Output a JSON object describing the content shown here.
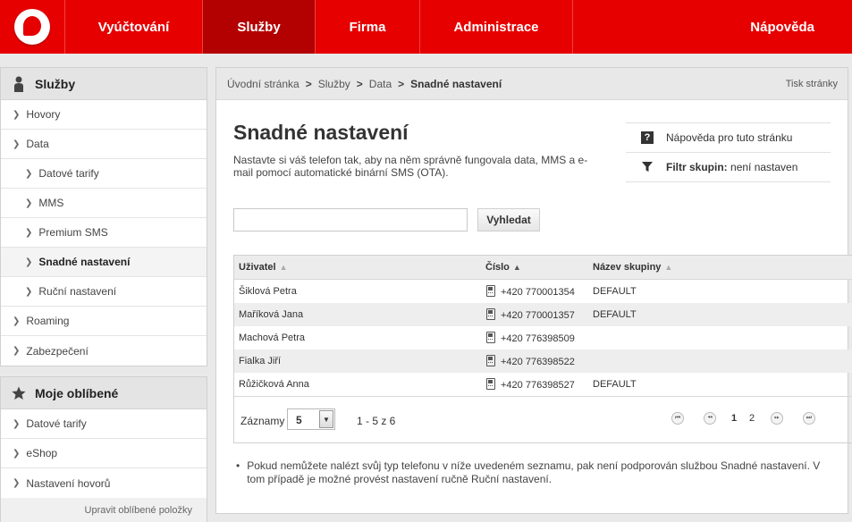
{
  "nav": {
    "items": [
      "Vyúčtování",
      "Služby",
      "Firma",
      "Administrace",
      "Nápověda"
    ],
    "active": "Služby"
  },
  "sidebar": {
    "title": "Služby",
    "items": [
      {
        "label": "Hovory",
        "level": 1
      },
      {
        "label": "Data",
        "level": 1
      },
      {
        "label": "Datové tarify",
        "level": 2
      },
      {
        "label": "MMS",
        "level": 2
      },
      {
        "label": "Premium SMS",
        "level": 2
      },
      {
        "label": "Snadné nastavení",
        "level": 2,
        "current": true
      },
      {
        "label": "Ruční nastavení",
        "level": 2
      },
      {
        "label": "Roaming",
        "level": 1
      },
      {
        "label": "Zabezpečení",
        "level": 1
      }
    ]
  },
  "favorites": {
    "title": "Moje oblíbené",
    "items": [
      "Datové tarify",
      "eShop",
      "Nastavení hovorů"
    ],
    "edit_label": "Upravit oblíbené položky"
  },
  "breadcrumb": {
    "items": [
      "Úvodní stránka",
      "Služby",
      "Data"
    ],
    "current": "Snadné nastavení",
    "separator": ">"
  },
  "print_label": "Tisk stránky",
  "page": {
    "title": "Snadné nastavení",
    "description": "Nastavte si váš telefon tak, aby na něm správně fungovala data, MMS a e-mail pomocí automatické binární SMS (OTA)."
  },
  "help": {
    "help_label": "Nápověda pro tuto stránku",
    "filter_label": "Filtr skupin:",
    "filter_value": "není nastaven"
  },
  "search": {
    "value": "",
    "button_label": "Vyhledat"
  },
  "table": {
    "headers": [
      "Uživatel",
      "Číslo",
      "Název skupiny"
    ],
    "rows": [
      {
        "user": "Šiklová Petra",
        "number": "+420 770001354",
        "group": "DEFAULT"
      },
      {
        "user": "Maříková Jana",
        "number": "+420 770001357",
        "group": "DEFAULT"
      },
      {
        "user": "Machová Petra",
        "number": "+420 776398509",
        "group": ""
      },
      {
        "user": "Fialka Jiří",
        "number": "+420 776398522",
        "group": ""
      },
      {
        "user": "Růžičková Anna",
        "number": "+420 776398527",
        "group": "DEFAULT"
      }
    ]
  },
  "pager": {
    "records_label": "Záznamy",
    "page_size": "5",
    "range": "1 - 5 z 6",
    "pages": [
      "1",
      "2"
    ],
    "current_page": "1"
  },
  "note": "Pokud nemůžete nalézt svůj typ telefonu v níže uvedeném seznamu, pak není podporován službou Snadné nastavení. V tom případě je možné provést nastavení ručně Ruční nastavení.",
  "colors": {
    "brand": "#e60000",
    "brand_active": "#b30000"
  }
}
